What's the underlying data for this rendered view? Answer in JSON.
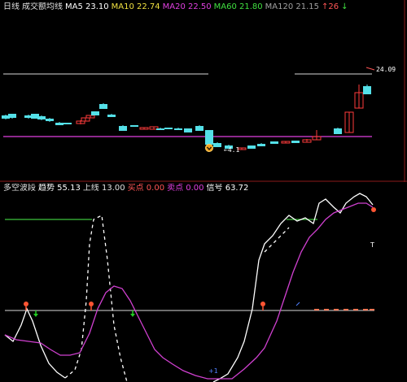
{
  "colors": {
    "background": "#000000",
    "panel_border": "#8b1a1a",
    "candle_up": "#ff3b3b",
    "candle_down": "#54e0e8",
    "support_line": "#e040e0",
    "reference_line": "#d8d8d8",
    "green_line": "#3cc43c",
    "white_line": "#ffffff",
    "magenta_line": "#d040d0",
    "buy_arrow": "#ff5533",
    "sell_arrow": "#22cc22"
  },
  "main_header": {
    "items": [
      {
        "text": "日线",
        "color": "#e0e0e0"
      },
      {
        "text": "成交额均线",
        "color": "#e0e0e0"
      },
      {
        "text": "MA5 23.10",
        "color": "#ffffff"
      },
      {
        "text": "MA10 22.74",
        "color": "#f0e040"
      },
      {
        "text": "MA20 22.50",
        "color": "#e040e0"
      },
      {
        "text": "MA60 21.80",
        "color": "#40e040"
      },
      {
        "text": "MA120 21.15",
        "color": "#a0a0a0"
      },
      {
        "text": "↑26",
        "color": "#ff5555"
      },
      {
        "text": "↓",
        "color": "#40e040"
      }
    ]
  },
  "price_labels": {
    "high": "24.09",
    "low": "←4.1"
  },
  "indicator_header": {
    "items": [
      {
        "text": "多空波段",
        "color": "#e0e0e0"
      },
      {
        "text": "趋势 55.13",
        "color": "#ffffff"
      },
      {
        "text": "上线 13.00",
        "color": "#e0e0e0"
      },
      {
        "text": "买点 0.00",
        "color": "#ff5555"
      },
      {
        "text": "卖点 0.00",
        "color": "#e040e0"
      },
      {
        "text": "信号 63.72",
        "color": "#ffffff"
      }
    ]
  },
  "indicator_labels": {
    "right_marker": "T",
    "bottom_marker": "+1"
  },
  "icons": {
    "buy_arrow": "arrow-up-icon",
    "sell_arrow": "arrow-down-icon",
    "low_marker": "circle-marker-icon"
  }
}
